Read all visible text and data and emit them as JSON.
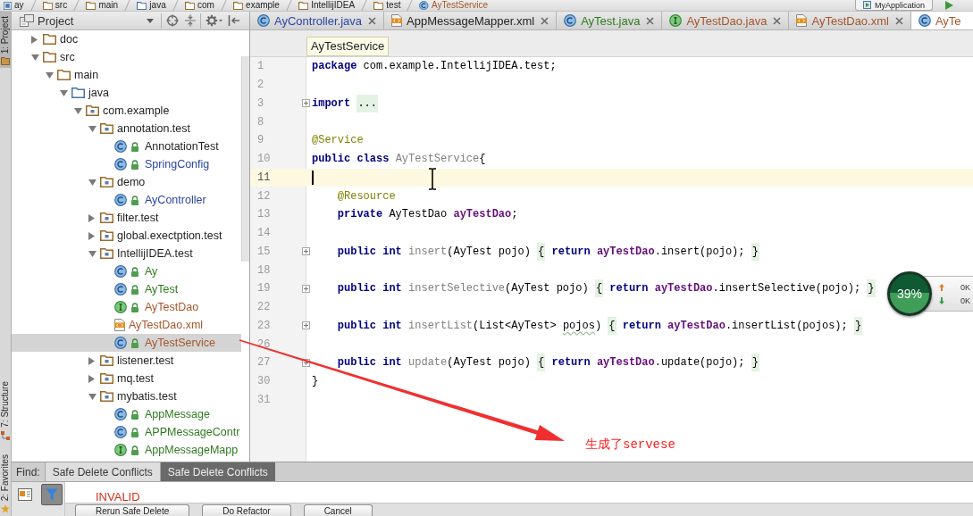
{
  "nav_bar": {
    "crumbs": [
      {
        "label": "ay",
        "kind": "module"
      },
      {
        "label": "src",
        "kind": "folder"
      },
      {
        "label": "main",
        "kind": "folder"
      },
      {
        "label": "java",
        "kind": "source"
      },
      {
        "label": "com",
        "kind": "folder"
      },
      {
        "label": "example",
        "kind": "folder"
      },
      {
        "label": "IntellijIDEA",
        "kind": "folder"
      },
      {
        "label": "test",
        "kind": "folder"
      },
      {
        "label": "AyTestService",
        "kind": "class",
        "color": "#a5562b"
      }
    ],
    "run_config": "MyApplication"
  },
  "tool_windows": [
    {
      "label": "1: Project",
      "kind": "project",
      "selected": true
    },
    {
      "label": "7: Structure",
      "kind": "structure",
      "selected": false
    },
    {
      "label": "2: Favorites",
      "kind": "favorites",
      "selected": false
    }
  ],
  "project_panel": {
    "title": "Project",
    "tree": [
      {
        "label": "doc",
        "kind": "folder",
        "expanded": false,
        "selected": false
      },
      {
        "label": "src",
        "kind": "folder",
        "expanded": true,
        "selected": false,
        "children": [
          {
            "label": "main",
            "kind": "folder",
            "expanded": true,
            "selected": false,
            "children": [
              {
                "label": "java",
                "kind": "source",
                "expanded": true,
                "selected": false,
                "children": [
                  {
                    "label": "com.example",
                    "kind": "package",
                    "expanded": true,
                    "selected": false,
                    "children": [
                      {
                        "label": "annotation.test",
                        "kind": "package",
                        "expanded": true,
                        "selected": false,
                        "children": [
                          {
                            "label": "AnnotationTest",
                            "kind": "class",
                            "color": "#1e1e1e",
                            "selected": false
                          },
                          {
                            "label": "SpringConfig",
                            "kind": "class",
                            "color": "#2b46a6",
                            "selected": false
                          }
                        ]
                      },
                      {
                        "label": "demo",
                        "kind": "package",
                        "expanded": true,
                        "selected": false,
                        "children": [
                          {
                            "label": "AyController",
                            "kind": "class",
                            "color": "#2b46a6",
                            "selected": false
                          }
                        ]
                      },
                      {
                        "label": "filter.test",
                        "kind": "package",
                        "expanded": false,
                        "selected": false
                      },
                      {
                        "label": "global.exectption.test",
                        "kind": "package",
                        "expanded": false,
                        "selected": false
                      },
                      {
                        "label": "IntellijIDEA.test",
                        "kind": "package",
                        "expanded": true,
                        "selected": false,
                        "children": [
                          {
                            "label": "Ay",
                            "kind": "class",
                            "color": "#2f7a1f",
                            "selected": false
                          },
                          {
                            "label": "AyTest",
                            "kind": "class",
                            "color": "#2f7a1f",
                            "selected": false
                          },
                          {
                            "label": "AyTestDao",
                            "kind": "interface",
                            "color": "#a5562b",
                            "selected": false
                          },
                          {
                            "label": "AyTestDao.xml",
                            "kind": "xml",
                            "color": "#a5562b",
                            "selected": false
                          },
                          {
                            "label": "AyTestService",
                            "kind": "class",
                            "color": "#a5562b",
                            "selected": true
                          }
                        ]
                      },
                      {
                        "label": "listener.test",
                        "kind": "package",
                        "expanded": false,
                        "selected": false
                      },
                      {
                        "label": "mq.test",
                        "kind": "package",
                        "expanded": false,
                        "selected": false
                      },
                      {
                        "label": "mybatis.test",
                        "kind": "package",
                        "expanded": true,
                        "selected": false,
                        "children": [
                          {
                            "label": "AppMessage",
                            "kind": "class",
                            "color": "#2f7a1f",
                            "selected": false
                          },
                          {
                            "label": "APPMessageContr",
                            "kind": "class",
                            "color": "#2f7a1f",
                            "selected": false
                          },
                          {
                            "label": "AppMessageMapp",
                            "kind": "interface",
                            "color": "#2f7a1f",
                            "selected": false
                          }
                        ]
                      }
                    ]
                  }
                ]
              }
            ]
          }
        ]
      }
    ]
  },
  "editor": {
    "tabs": [
      {
        "label": "AyController.java",
        "kind": "class",
        "color": "#2b46a6",
        "selected": false,
        "closable": true
      },
      {
        "label": "AppMessageMapper.xml",
        "kind": "xml",
        "color": "#1e1e1e",
        "selected": false,
        "closable": true
      },
      {
        "label": "AyTest.java",
        "kind": "class",
        "color": "#2f7a1f",
        "selected": false,
        "closable": true
      },
      {
        "label": "AyTestDao.java",
        "kind": "interface",
        "color": "#a5562b",
        "selected": false,
        "closable": true
      },
      {
        "label": "AyTestDao.xml",
        "kind": "xml",
        "color": "#a5562b",
        "selected": false,
        "closable": true
      },
      {
        "label": "AyTe",
        "kind": "class",
        "color": "#a5562b",
        "selected": true,
        "closable": false
      }
    ],
    "breadcrumb": "AyTestService",
    "lines": [
      {
        "number": "1",
        "current": false,
        "folded": false,
        "tokens": [
          {
            "kind": "keyword",
            "text": "package"
          },
          {
            "kind": "plain",
            "text": " com.example.IntellijIDEA.test;"
          }
        ]
      },
      {
        "number": "2",
        "current": false,
        "folded": false
      },
      {
        "number": "3",
        "current": false,
        "folded": true,
        "tokens": [
          {
            "kind": "keyword",
            "text": "import "
          },
          {
            "kind": "fold",
            "text": "..."
          }
        ]
      },
      {
        "number": "8",
        "current": false,
        "folded": false
      },
      {
        "number": "9",
        "current": false,
        "folded": false,
        "tokens": [
          {
            "kind": "annotation",
            "text": "@Service"
          }
        ]
      },
      {
        "number": "10",
        "current": false,
        "folded": false,
        "tokens": [
          {
            "kind": "keyword",
            "text": "public class "
          },
          {
            "kind": "unused",
            "text": "AyTestService"
          },
          {
            "kind": "plain",
            "text": "{"
          }
        ]
      },
      {
        "number": "11",
        "current": true,
        "folded": false
      },
      {
        "number": "12",
        "current": false,
        "folded": false,
        "tokens": [
          {
            "kind": "annotation",
            "text": "    @Resource"
          }
        ]
      },
      {
        "number": "13",
        "current": false,
        "folded": false,
        "tokens": [
          {
            "kind": "keyword",
            "text": "    private"
          },
          {
            "kind": "plain",
            "text": " AyTestDao "
          },
          {
            "kind": "field",
            "text": "ayTestDao"
          },
          {
            "kind": "plain",
            "text": ";"
          }
        ]
      },
      {
        "number": "14",
        "current": false,
        "folded": false
      },
      {
        "number": "15",
        "current": false,
        "folded": true,
        "tokens": [
          {
            "kind": "keyword",
            "text": "    public int "
          },
          {
            "kind": "unused",
            "text": "insert"
          },
          {
            "kind": "plain",
            "text": "(AyTest pojo) "
          },
          {
            "kind": "fold",
            "text": "{"
          },
          {
            "kind": "keyword",
            "text": " return "
          },
          {
            "kind": "field",
            "text": "ayTestDao"
          },
          {
            "kind": "plain",
            "text": ".insert(pojo); "
          },
          {
            "kind": "fold",
            "text": "}"
          }
        ]
      },
      {
        "number": "18",
        "current": false,
        "folded": false
      },
      {
        "number": "19",
        "current": false,
        "folded": true,
        "tokens": [
          {
            "kind": "keyword",
            "text": "    public int "
          },
          {
            "kind": "unused",
            "text": "insertSelective"
          },
          {
            "kind": "plain",
            "text": "(AyTest pojo) "
          },
          {
            "kind": "fold",
            "text": "{"
          },
          {
            "kind": "keyword",
            "text": " return "
          },
          {
            "kind": "field",
            "text": "ayTestDao"
          },
          {
            "kind": "plain",
            "text": ".insertSelective(pojo); "
          },
          {
            "kind": "fold",
            "text": "}"
          }
        ]
      },
      {
        "number": "22",
        "current": false,
        "folded": false
      },
      {
        "number": "23",
        "current": false,
        "folded": true,
        "tokens": [
          {
            "kind": "keyword",
            "text": "    public int "
          },
          {
            "kind": "unused",
            "text": "insertList"
          },
          {
            "kind": "plain",
            "text": "(List<AyTest> "
          },
          {
            "kind": "typo",
            "text": "pojos"
          },
          {
            "kind": "plain",
            "text": ") "
          },
          {
            "kind": "fold",
            "text": "{"
          },
          {
            "kind": "keyword",
            "text": " return "
          },
          {
            "kind": "field",
            "text": "ayTestDao"
          },
          {
            "kind": "plain",
            "text": ".insertList(pojos); "
          },
          {
            "kind": "fold",
            "text": "}"
          }
        ]
      },
      {
        "number": "26",
        "current": false,
        "folded": false
      },
      {
        "number": "27",
        "current": false,
        "folded": true,
        "tokens": [
          {
            "kind": "keyword",
            "text": "    public int "
          },
          {
            "kind": "unused",
            "text": "update"
          },
          {
            "kind": "plain",
            "text": "(AyTest pojo) "
          },
          {
            "kind": "fold",
            "text": "{"
          },
          {
            "kind": "keyword",
            "text": " return "
          },
          {
            "kind": "field",
            "text": "ayTestDao"
          },
          {
            "kind": "plain",
            "text": ".update(pojo); "
          },
          {
            "kind": "fold",
            "text": "}"
          }
        ]
      },
      {
        "number": "30",
        "current": false,
        "folded": false,
        "tokens": [
          {
            "kind": "plain",
            "text": "}"
          }
        ]
      },
      {
        "number": "31",
        "current": false,
        "folded": false
      }
    ]
  },
  "find_panel": {
    "label": "Find:",
    "tabs": [
      {
        "label": "Safe Delete Conflicts",
        "selected": false
      },
      {
        "label": "Safe Delete Conflicts",
        "selected": true
      }
    ],
    "tools": [
      {
        "kind": "preview",
        "selected": false
      },
      {
        "kind": "filter",
        "selected": true
      }
    ],
    "results": [
      "INVALID"
    ],
    "buttons": [
      "Rerun Safe Delete",
      "Do Refactor",
      "Cancel"
    ]
  },
  "speed_widget": {
    "percent": "39%",
    "upload": "0K",
    "download": "0K"
  },
  "annotation": {
    "text": "生成了servese"
  }
}
